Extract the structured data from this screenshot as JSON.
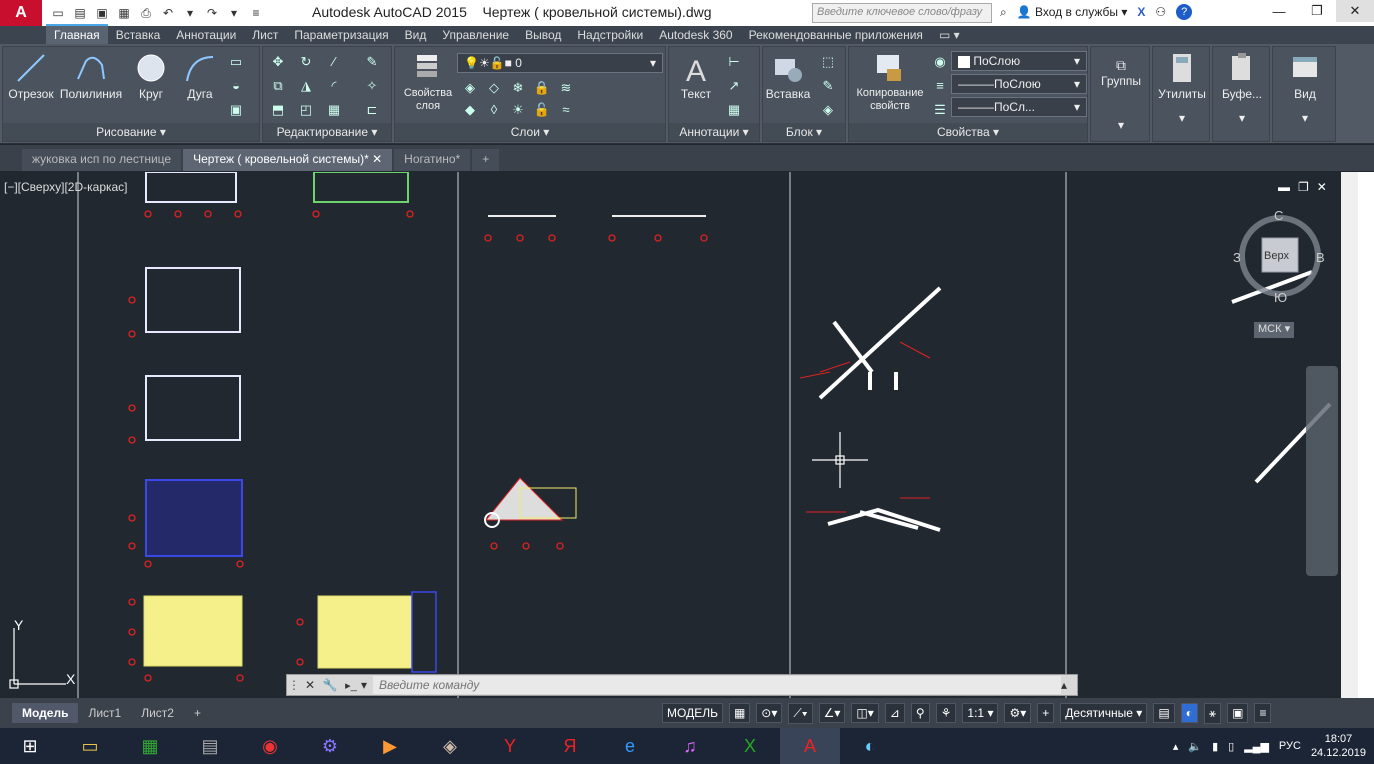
{
  "app": {
    "logo": "A",
    "title": "Autodesk AutoCAD 2015    Чертеж ( кровельной системы).dwg",
    "search_placeholder": "Введите ключевое слово/фразу",
    "signin": "Вход в службы",
    "x_icon": "X",
    "help": "?"
  },
  "ribbon_tabs": [
    "Главная",
    "Вставка",
    "Аннотации",
    "Лист",
    "Параметризация",
    "Вид",
    "Управление",
    "Вывод",
    "Надстройки",
    "Autodesk 360",
    "Рекомендованные приложения"
  ],
  "panels": {
    "draw": "Рисование",
    "modify": "Редактирование",
    "layers": "Слои",
    "annotations": "Аннотации",
    "block": "Блок",
    "properties": "Свойства"
  },
  "buttons": {
    "line": "Отрезок",
    "polyline": "Полилиния",
    "circle": "Круг",
    "arc": "Дуга",
    "layer_props": "Свойства слоя",
    "text": "Текст",
    "insert": "Вставка",
    "copy_props": "Копирование свойств",
    "groups": "Группы",
    "utilities": "Утилиты",
    "clipboard": "Буфе...",
    "view": "Вид"
  },
  "layer_dropdown": "0",
  "prop_color": "ПоСлою",
  "prop_linetype": "———ПоСлою",
  "prop_lineweight": "———ПоСл...",
  "doc_tabs": [
    "жуковка исп по лестнице",
    "Чертеж ( кровельной системы)*",
    "Ногатино*"
  ],
  "viewport_label": "[−][Сверху][2D-каркас]",
  "viewcube": {
    "top": "Верх",
    "north": "С",
    "west": "З",
    "east": "В",
    "south": "Ю",
    "ucs": "МСК"
  },
  "command_placeholder": "Введите команду",
  "layout_tabs": [
    "Модель",
    "Лист1",
    "Лист2"
  ],
  "status": {
    "model": "МОДЕЛЬ",
    "scale": "1:1",
    "units": "Десятичные"
  },
  "tray": {
    "lang": "РУС",
    "time": "18:07",
    "date": "24.12.2019"
  },
  "colors": {
    "canvas": "#212830",
    "accent_blue": "#3a78d8",
    "red": "#e02020"
  }
}
